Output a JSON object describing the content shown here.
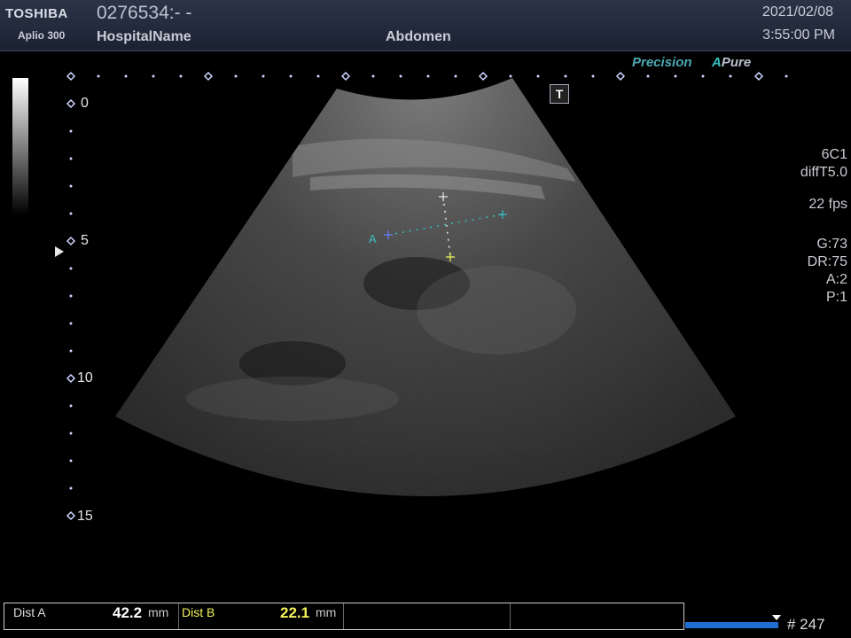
{
  "header": {
    "brand": "TOSHIBA",
    "model": "Aplio 300",
    "patient_id": "0276534:- -",
    "hospital": "HospitalName",
    "exam": "Abdomen",
    "date": "2021/02/08",
    "time": "3:55:00 PM"
  },
  "overlay": {
    "precision_label": "Precision",
    "apure_prefix": "A",
    "apure_label": "Pure",
    "t_marker": "T",
    "caliper_label": "A"
  },
  "params": {
    "probe": "6C1",
    "preset": "diffT5.0",
    "fps": "22 fps",
    "gain": "G:73",
    "dynamic_range": "DR:75",
    "a": "A:2",
    "p": "P:1"
  },
  "depth_scale": [
    "0",
    "5",
    "10",
    "15"
  ],
  "measurements": [
    {
      "label": "Dist A",
      "value": "42.2",
      "unit": "mm",
      "value_color": "#ffffff"
    },
    {
      "label": "Dist B",
      "value": "22.1",
      "unit": "mm",
      "value_color": "#f4f45a"
    }
  ],
  "cine": {
    "frame": "# 247"
  },
  "colors": {
    "caliper_a": "#35c0c0",
    "caliper_b": "#f4f45a",
    "header_bg": "#232b3d",
    "cine": "#1e6fd0"
  }
}
